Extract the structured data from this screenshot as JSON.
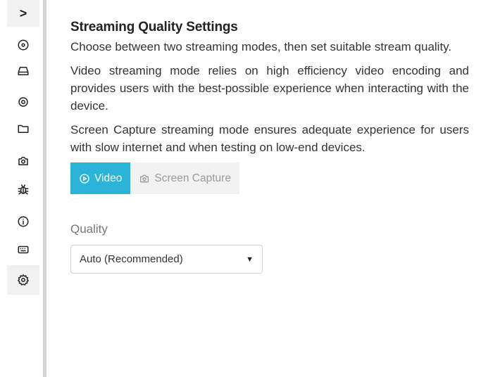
{
  "sidebar": {
    "expand_glyph": ">",
    "items": [
      {
        "icon": "disc-icon"
      },
      {
        "icon": "drive-icon"
      },
      {
        "icon": "location-target-icon"
      },
      {
        "icon": "folder-icon"
      },
      {
        "icon": "camera-icon"
      },
      {
        "icon": "bug-icon"
      },
      {
        "icon": "info-icon"
      },
      {
        "icon": "keyboard-icon"
      },
      {
        "icon": "gear-icon",
        "active": true
      }
    ]
  },
  "main": {
    "title": "Streaming Quality Settings",
    "paragraphs": [
      "Choose between two streaming modes, then set suitable stream quality.",
      "Video streaming mode relies on high efficiency video encoding and provides users with the best-possible experience when interacting with the device.",
      "Screen Capture streaming mode ensures adequate experience for users with slow internet and when testing on low-end devices."
    ],
    "modes": [
      {
        "label": "Video",
        "icon": "play-circle-icon",
        "selected": true
      },
      {
        "label": "Screen Capture",
        "icon": "camera-icon",
        "selected": false
      }
    ],
    "quality_label": "Quality",
    "quality_value": "Auto (Recommended)",
    "caret": "▼"
  },
  "colors": {
    "accent": "#2bb4d8",
    "inactive_bg": "#f2f2f2",
    "sidebar_strip": "#d4d4d4"
  }
}
